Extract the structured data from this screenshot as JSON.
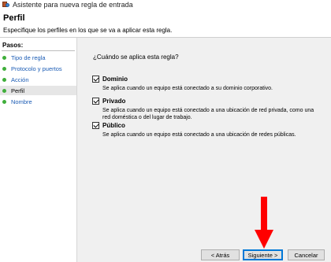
{
  "window": {
    "title": "Asistente para nueva regla de entrada"
  },
  "header": {
    "title": "Perfil",
    "subtitle": "Especifique los perfiles en los que se va a aplicar esta regla."
  },
  "steps": {
    "heading": "Pasos:",
    "items": [
      {
        "label": "Tipo de regla",
        "active": false
      },
      {
        "label": "Protocolo y puertos",
        "active": false
      },
      {
        "label": "Acción",
        "active": false
      },
      {
        "label": "Perfil",
        "active": true
      },
      {
        "label": "Nombre",
        "active": false
      }
    ]
  },
  "main": {
    "question": "¿Cuándo se aplica esta regla?",
    "options": [
      {
        "label": "Dominio",
        "checked": true,
        "description": "Se aplica cuando un equipo está conectado a su dominio corporativo."
      },
      {
        "label": "Privado",
        "checked": true,
        "description": "Se aplica cuando un equipo está conectado a una ubicación de red privada, como una red doméstica o del lugar de trabajo."
      },
      {
        "label": "Público",
        "checked": true,
        "description": "Se aplica cuando un equipo está conectado a una ubicación de redes públicas."
      }
    ]
  },
  "buttons": {
    "back": "< Atrás",
    "next": "Siguiente >",
    "cancel": "Cancelar"
  },
  "colors": {
    "accent": "#0078d7",
    "arrow": "#ff0000",
    "step_dot": "#3fae3a",
    "link": "#1a5bb4"
  }
}
